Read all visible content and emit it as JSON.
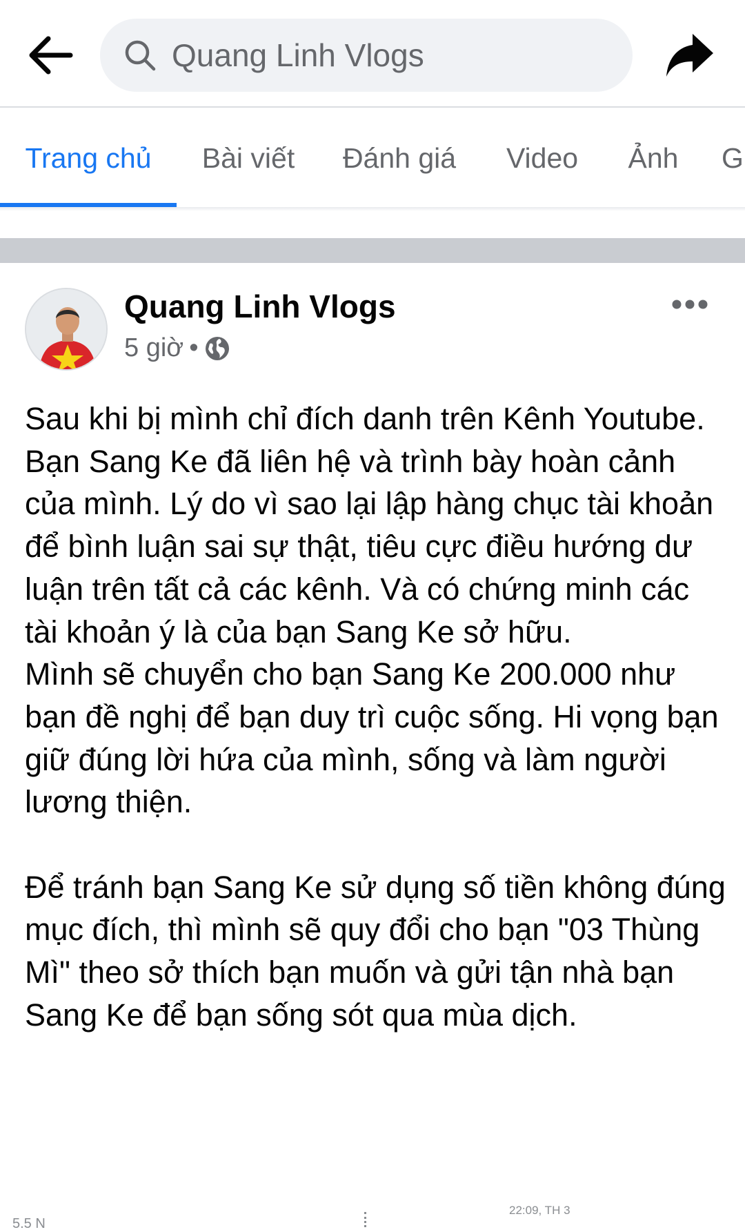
{
  "header": {
    "search_query": "Quang Linh Vlogs",
    "icons": {
      "back": "arrow-left-icon",
      "search": "search-icon",
      "share": "share-arrow-icon"
    }
  },
  "tabs": [
    {
      "label": "Trang chủ",
      "active": true
    },
    {
      "label": "Bài viết",
      "active": false
    },
    {
      "label": "Đánh giá",
      "active": false
    },
    {
      "label": "Video",
      "active": false
    },
    {
      "label": "Ảnh",
      "active": false
    },
    {
      "label": "G",
      "active": false
    }
  ],
  "post": {
    "author": "Quang Linh Vlogs",
    "time": "5 giờ",
    "meta_separator": "•",
    "audience_icon": "globe-icon",
    "more_icon": "more-horizontal-icon",
    "paragraphs": [
      "Sau khi bị mình chỉ đích danh trên Kênh Youtube.",
      "Bạn Sang Ke đã liên hệ và trình bày hoàn cảnh của mình. Lý do vì sao lại lập hàng chục tài khoản để bình luận sai sự thật, tiêu cực điều hướng dư luận trên tất cả các kênh. Và có chứng minh các tài khoản ý là của bạn Sang Ke sở hữu.",
      "Mình sẽ chuyển cho bạn Sang Ke 200.000 như bạn đề nghị để bạn duy trì cuộc sống. Hi vọng bạn giữ đúng lời hứa của mình, sống và làm người lương thiện.",
      "Để tránh bạn Sang Ke sử dụng số tiền không đúng mục đích, thì mình sẽ quy đổi cho bạn \"03 Thùng Mì\" theo sở thích bạn muốn và gửi tận nhà bạn Sang Ke để bạn sống sót qua mùa dịch."
    ]
  },
  "footer": {
    "left_text": "5.5 N",
    "timestamp": "22:09, TH 3"
  },
  "colors": {
    "accent": "#1877f2",
    "secondary_text": "#65676b",
    "search_bg": "#f0f2f5",
    "separator": "#c9ccd1"
  }
}
